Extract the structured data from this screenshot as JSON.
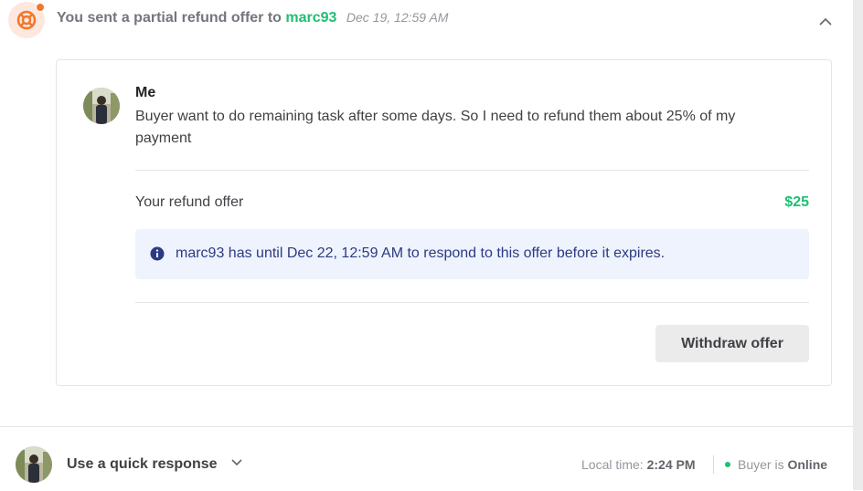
{
  "colors": {
    "accent_green": "#1dbf73",
    "notification_orange": "#f1772b",
    "info_background": "#eef3fd",
    "info_text": "#2c3a83"
  },
  "activity": {
    "icon": "lifebuoy-icon",
    "prefix": "You sent a partial refund offer to",
    "username": "marc93",
    "timestamp": "Dec 19, 12:59 AM",
    "collapse_icon": "chevron-up-icon"
  },
  "message": {
    "sender": "Me",
    "text": "Buyer want to do remaining task after some days. So I need to refund them about 25% of my payment"
  },
  "offer": {
    "label": "Your refund offer",
    "amount": "$25",
    "notice": "marc93 has until Dec 22, 12:59 AM to respond to this offer before it expires.",
    "notice_icon": "info-icon",
    "withdraw_label": "Withdraw offer"
  },
  "footer": {
    "quick_response_label": "Use a quick response",
    "dropdown_icon": "chevron-down-icon",
    "local_time_label": "Local time:",
    "local_time_value": "2:24 PM",
    "buyer_label": "Buyer is",
    "buyer_status": "Online"
  }
}
